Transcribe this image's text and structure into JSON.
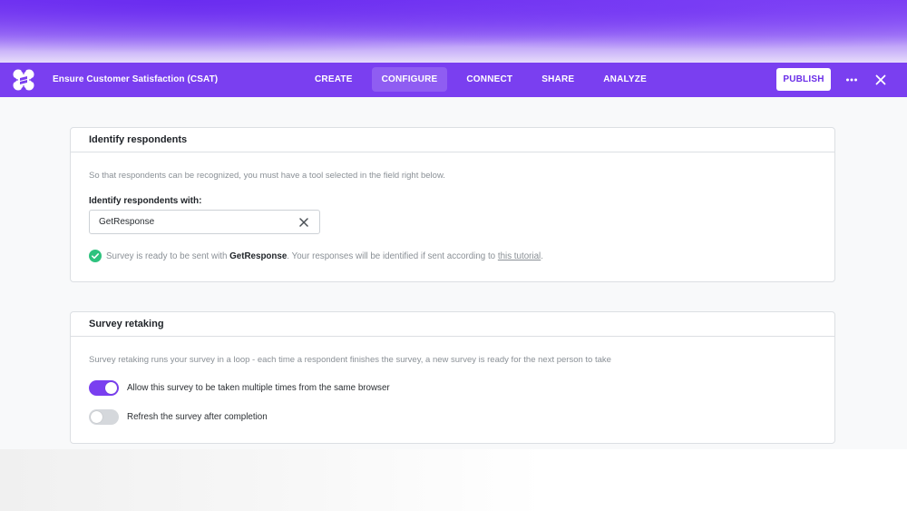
{
  "header": {
    "survey_title": "Ensure Customer Satisfaction (CSAT)",
    "tabs": [
      {
        "label": "CREATE",
        "active": false
      },
      {
        "label": "CONFIGURE",
        "active": true
      },
      {
        "label": "CONNECT",
        "active": false
      },
      {
        "label": "SHARE",
        "active": false
      },
      {
        "label": "ANALYZE",
        "active": false
      }
    ],
    "publish_label": "PUBLISH",
    "icons": {
      "logo": "brand-logo",
      "more": "more-dots-icon",
      "close": "close-icon"
    },
    "accent_color": "#7a3ff0"
  },
  "identify": {
    "title": "Identify respondents",
    "description": "So that respondents can be recognized, you must have a tool selected in the field right below.",
    "field_label": "Identify respondents with:",
    "selected_value": "GetResponse",
    "status_prefix": "Survey is ready to be sent with ",
    "status_tool": "GetResponse",
    "status_middle": ".  Your responses will be identified if sent according to ",
    "status_link": "this tutorial",
    "status_suffix": ".",
    "status_color": "#2ec27e"
  },
  "retaking": {
    "title": "Survey retaking",
    "description": "Survey retaking runs your survey in a loop - each time a respondent finishes the survey, a new survey is ready for the next person to take",
    "options": [
      {
        "label": "Allow this survey to be taken multiple times from the same browser",
        "enabled": true
      },
      {
        "label": "Refresh the survey after completion",
        "enabled": false
      }
    ]
  }
}
